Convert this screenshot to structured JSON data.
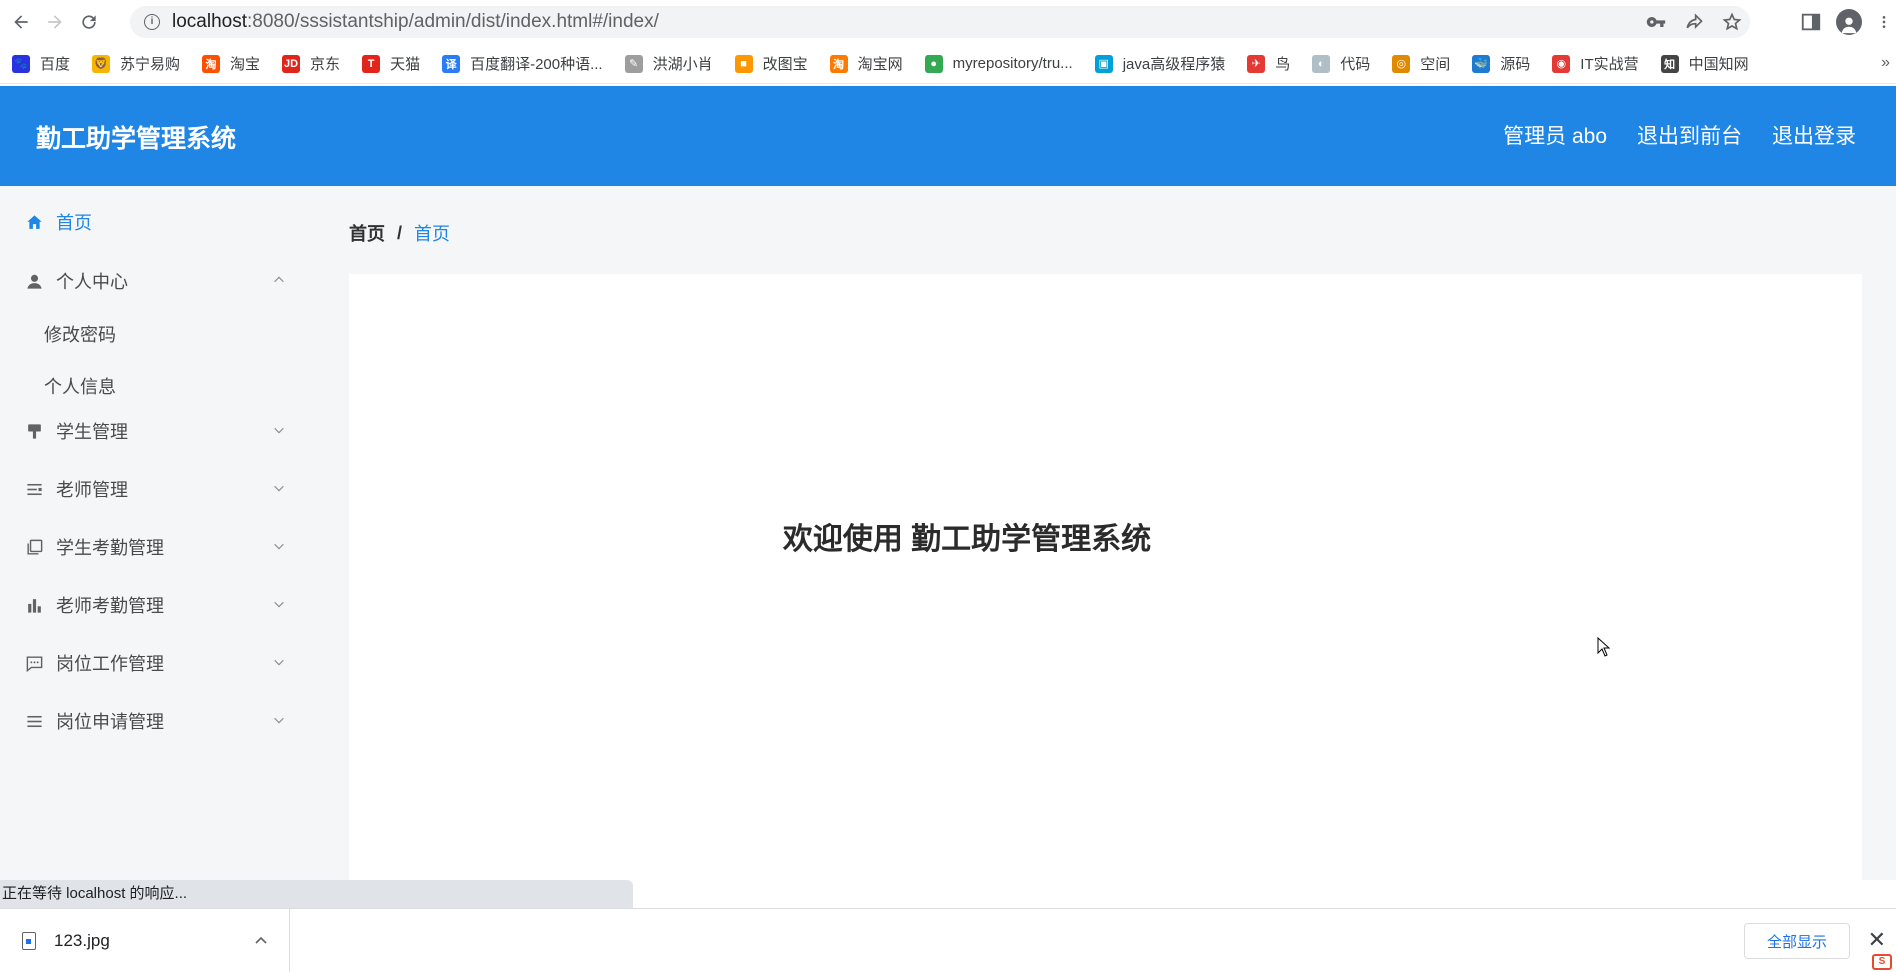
{
  "browser": {
    "url_host": "localhost",
    "url_rest": ":8080/sssistantship/admin/dist/index.html#/index/",
    "bookmarks": [
      {
        "label": "百度",
        "icon": "baidu-icon",
        "color": "#2932e1",
        "glyph": "🐾"
      },
      {
        "label": "苏宁易购",
        "icon": "suning-icon",
        "color": "#f7b500",
        "glyph": "🦁"
      },
      {
        "label": "淘宝",
        "icon": "taobao-icon",
        "color": "#ff5000",
        "glyph": "淘"
      },
      {
        "label": "京东",
        "icon": "jd-icon",
        "color": "#e1251b",
        "glyph": "JD"
      },
      {
        "label": "天猫",
        "icon": "tmall-icon",
        "color": "#e1251b",
        "glyph": "T"
      },
      {
        "label": "百度翻译-200种语...",
        "icon": "baidu-translate-icon",
        "color": "#2a7cf6",
        "glyph": "译"
      },
      {
        "label": "洪湖小肖",
        "icon": "bird-icon",
        "color": "#9e9e9e",
        "glyph": "✎"
      },
      {
        "label": "改图宝",
        "icon": "gaitubao-icon",
        "color": "#ff9800",
        "glyph": "■"
      },
      {
        "label": "淘宝网",
        "icon": "taobao-net-icon",
        "color": "#ff7a00",
        "glyph": "淘"
      },
      {
        "label": "myrepository/tru...",
        "icon": "chrome-icon",
        "color": "#34a853",
        "glyph": "●"
      },
      {
        "label": "java高级程序猿",
        "icon": "bilibili-icon",
        "color": "#00a1d6",
        "glyph": "▣"
      },
      {
        "label": "鸟",
        "icon": "bird-red-icon",
        "color": "#e53935",
        "glyph": "✈"
      },
      {
        "label": "代码",
        "icon": "code-icon",
        "color": "#b0bec5",
        "glyph": "◐"
      },
      {
        "label": "空间",
        "icon": "qzone-icon",
        "color": "#e08a00",
        "glyph": "◎"
      },
      {
        "label": "源码",
        "icon": "docker-icon",
        "color": "#1d7bd1",
        "glyph": "🐳"
      },
      {
        "label": "IT实战营",
        "icon": "it-camp-icon",
        "color": "#e53935",
        "glyph": "◉"
      },
      {
        "label": "中国知网",
        "icon": "cnki-icon",
        "color": "#444444",
        "glyph": "知"
      }
    ],
    "more": "»"
  },
  "header": {
    "title": "勤工助学管理系统",
    "admin_label": "管理员 abo",
    "exit_front": "退出到前台",
    "logout": "退出登录"
  },
  "sidebar": {
    "home": "首页",
    "personal_center": "个人中心",
    "change_password": "修改密码",
    "personal_info": "个人信息",
    "student_mgmt": "学生管理",
    "teacher_mgmt": "老师管理",
    "student_attendance": "学生考勤管理",
    "teacher_attendance": "老师考勤管理",
    "post_work": "岗位工作管理",
    "post_apply": "岗位申请管理"
  },
  "main": {
    "breadcrumb_home": "首页",
    "breadcrumb_sep": "/",
    "breadcrumb_current": "首页",
    "welcome": "欢迎使用 勤工助学管理系统"
  },
  "status": {
    "loading": "正在等待 localhost 的响应..."
  },
  "downloads": {
    "file": "123.jpg",
    "show_all": "全部显示",
    "close": "✕"
  },
  "colors": {
    "primary": "#2086e6"
  }
}
